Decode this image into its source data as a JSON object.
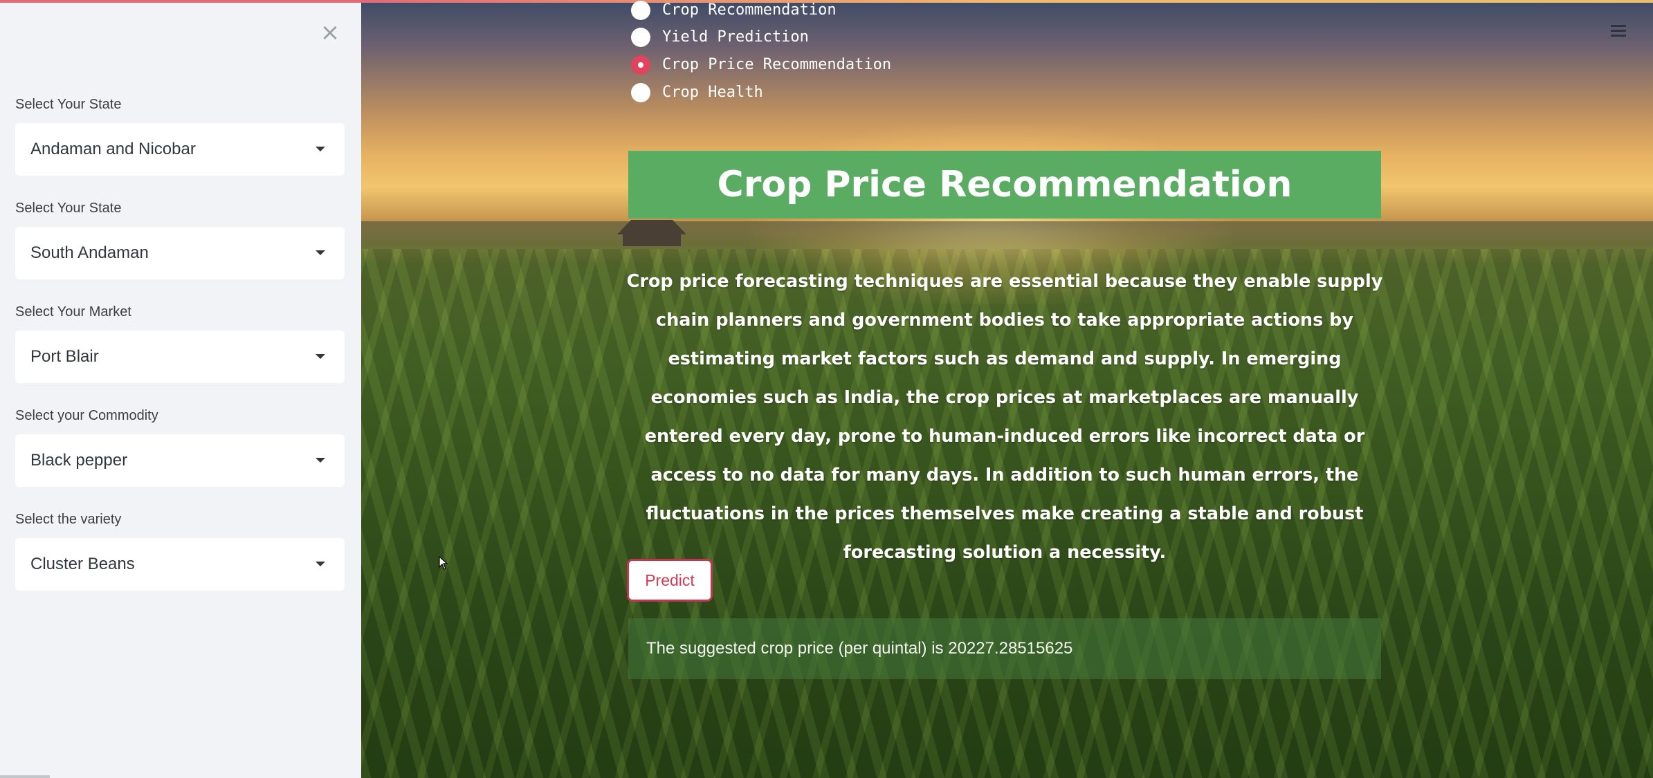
{
  "sidebar": {
    "close_label": "×",
    "fields": [
      {
        "label": "Select Your State",
        "value": "Andaman and Nicobar"
      },
      {
        "label": "Select Your State",
        "value": "South Andaman"
      },
      {
        "label": "Select Your Market",
        "value": "Port Blair"
      },
      {
        "label": "Select your Commodity",
        "value": "Black pepper"
      },
      {
        "label": "Select the variety",
        "value": "Cluster Beans"
      }
    ]
  },
  "nav": {
    "options": [
      {
        "label": "Crop Recommendation",
        "selected": false
      },
      {
        "label": "Yield Prediction",
        "selected": false
      },
      {
        "label": "Crop Price Recommendation",
        "selected": true
      },
      {
        "label": "Crop Health",
        "selected": false
      }
    ]
  },
  "main": {
    "title": "Crop Price Recommendation",
    "description": "Crop price forecasting techniques are essential because they enable supply chain planners and government bodies to take appropriate actions by estimating market factors such as demand and supply. In emerging economies such as India, the crop prices at marketplaces are manually entered every day, prone to human-induced errors like incorrect data or access to no data for many days. In addition to such human errors, the fluctuations in the prices themselves make creating a stable and robust forecasting solution a necessity.",
    "predict_label": "Predict",
    "result_text": "The suggested crop price (per quintal) is 20227.28515625"
  },
  "icons": {
    "close": "close-icon",
    "caret": "chevron-down-icon",
    "menu": "hamburger-menu-icon"
  },
  "colors": {
    "accent": "#e0435b",
    "banner": "#5aac62",
    "sidebar_bg": "#f1f3f6"
  }
}
